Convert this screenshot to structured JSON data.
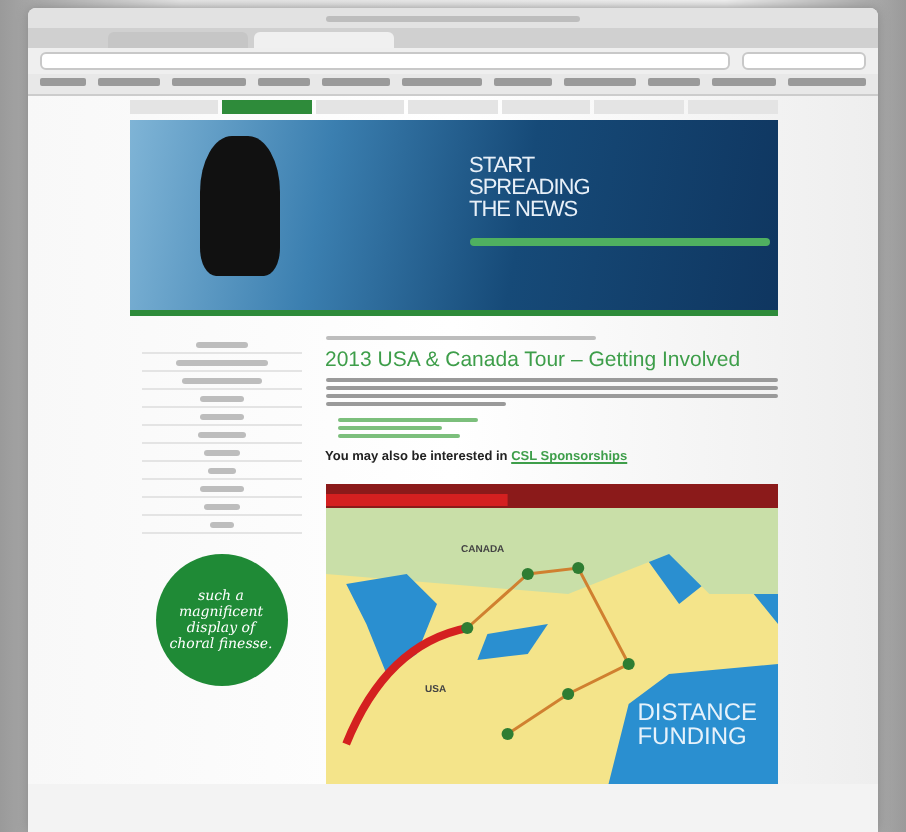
{
  "nav": [
    {
      "selected": false
    },
    {
      "selected": true
    },
    {
      "selected": false
    },
    {
      "selected": false
    },
    {
      "selected": false
    },
    {
      "selected": false
    },
    {
      "selected": false
    }
  ],
  "banner": {
    "headline": [
      "START",
      "SPREADING",
      "THE NEWS"
    ]
  },
  "article": {
    "title": "2013 USA & Canada Tour – Getting Involved",
    "related_label": "You may also be interested in",
    "related_link": "CSL Sponsorships"
  },
  "badge": {
    "quote": "such a magnificent display of choral finesse."
  },
  "map": {
    "country_labels": [
      "CANADA",
      "USA"
    ],
    "caption": [
      "DISTANCE",
      "FUNDING"
    ]
  }
}
